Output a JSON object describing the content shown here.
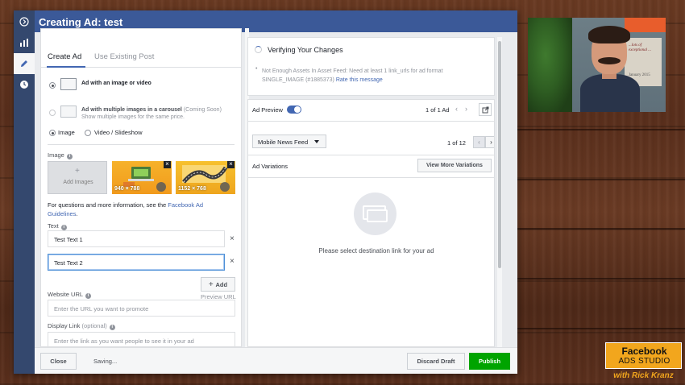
{
  "window": {
    "title": "Creating Ad: test"
  },
  "rail": {
    "icons": [
      "chevron-circle-icon",
      "bar-chart-icon",
      "pencil-icon",
      "clock-icon"
    ]
  },
  "left": {
    "tabs": [
      {
        "label": "Create Ad"
      },
      {
        "label": "Use Existing Post"
      }
    ],
    "formats": [
      {
        "title": "Ad with an image or video",
        "note": "",
        "desc": ""
      },
      {
        "title": "Ad with multiple images in a carousel",
        "note": "(Coming Soon)",
        "desc": "Show multiple images for the same price."
      }
    ],
    "media_types": [
      {
        "label": "Image"
      },
      {
        "label": "Video / Slideshow"
      }
    ],
    "image_label": "Image",
    "add_images": "Add Images",
    "thumbs": [
      {
        "dims": "940 × 788"
      },
      {
        "dims": "1152 × 768"
      }
    ],
    "help_prefix": "For questions and more information, see the ",
    "help_link": "Facebook Ad Guidelines",
    "help_suffix": ".",
    "text_label": "Text",
    "text_values": [
      "Test Text 1",
      "Test Text 2"
    ],
    "add_button": "Add",
    "preview_url": "Preview URL",
    "website_url_label": "Website URL",
    "website_url_placeholder": "Enter the URL you want to promote",
    "display_link_label": "Display Link",
    "display_link_optional": "(optional)",
    "display_link_placeholder": "Enter the link as you want people to see it in your ad"
  },
  "right": {
    "verify_title": "Verifying Your Changes",
    "verify_msg": "Not Enough Assets In Asset Feed: Need at least 1 link_urls for ad format SINGLE_IMAGE (#1885373)",
    "verify_link": "Rate this message",
    "ad_preview_label": "Ad Preview",
    "ad_count": "1 of 1 Ad",
    "placement": "Mobile News Feed",
    "placement_count": "1 of 12",
    "variations_label": "Ad Variations",
    "view_more": "View More Variations",
    "empty_msg": "Please select destination link for your ad"
  },
  "footer": {
    "close": "Close",
    "status": "Saving...",
    "discard": "Discard Draft",
    "publish": "Publish"
  },
  "webcam": {
    "poster_text": "...lots of exceptional ...",
    "poster_date": "January 2015"
  },
  "brand": {
    "line1": "Facebook",
    "line2": "ADS STUDIO",
    "line3": "with Rick Kranz"
  },
  "colors": {
    "header": "#3b5998",
    "accent": "#4267b2",
    "publish": "#00a400",
    "brand": "#f2a61d"
  }
}
